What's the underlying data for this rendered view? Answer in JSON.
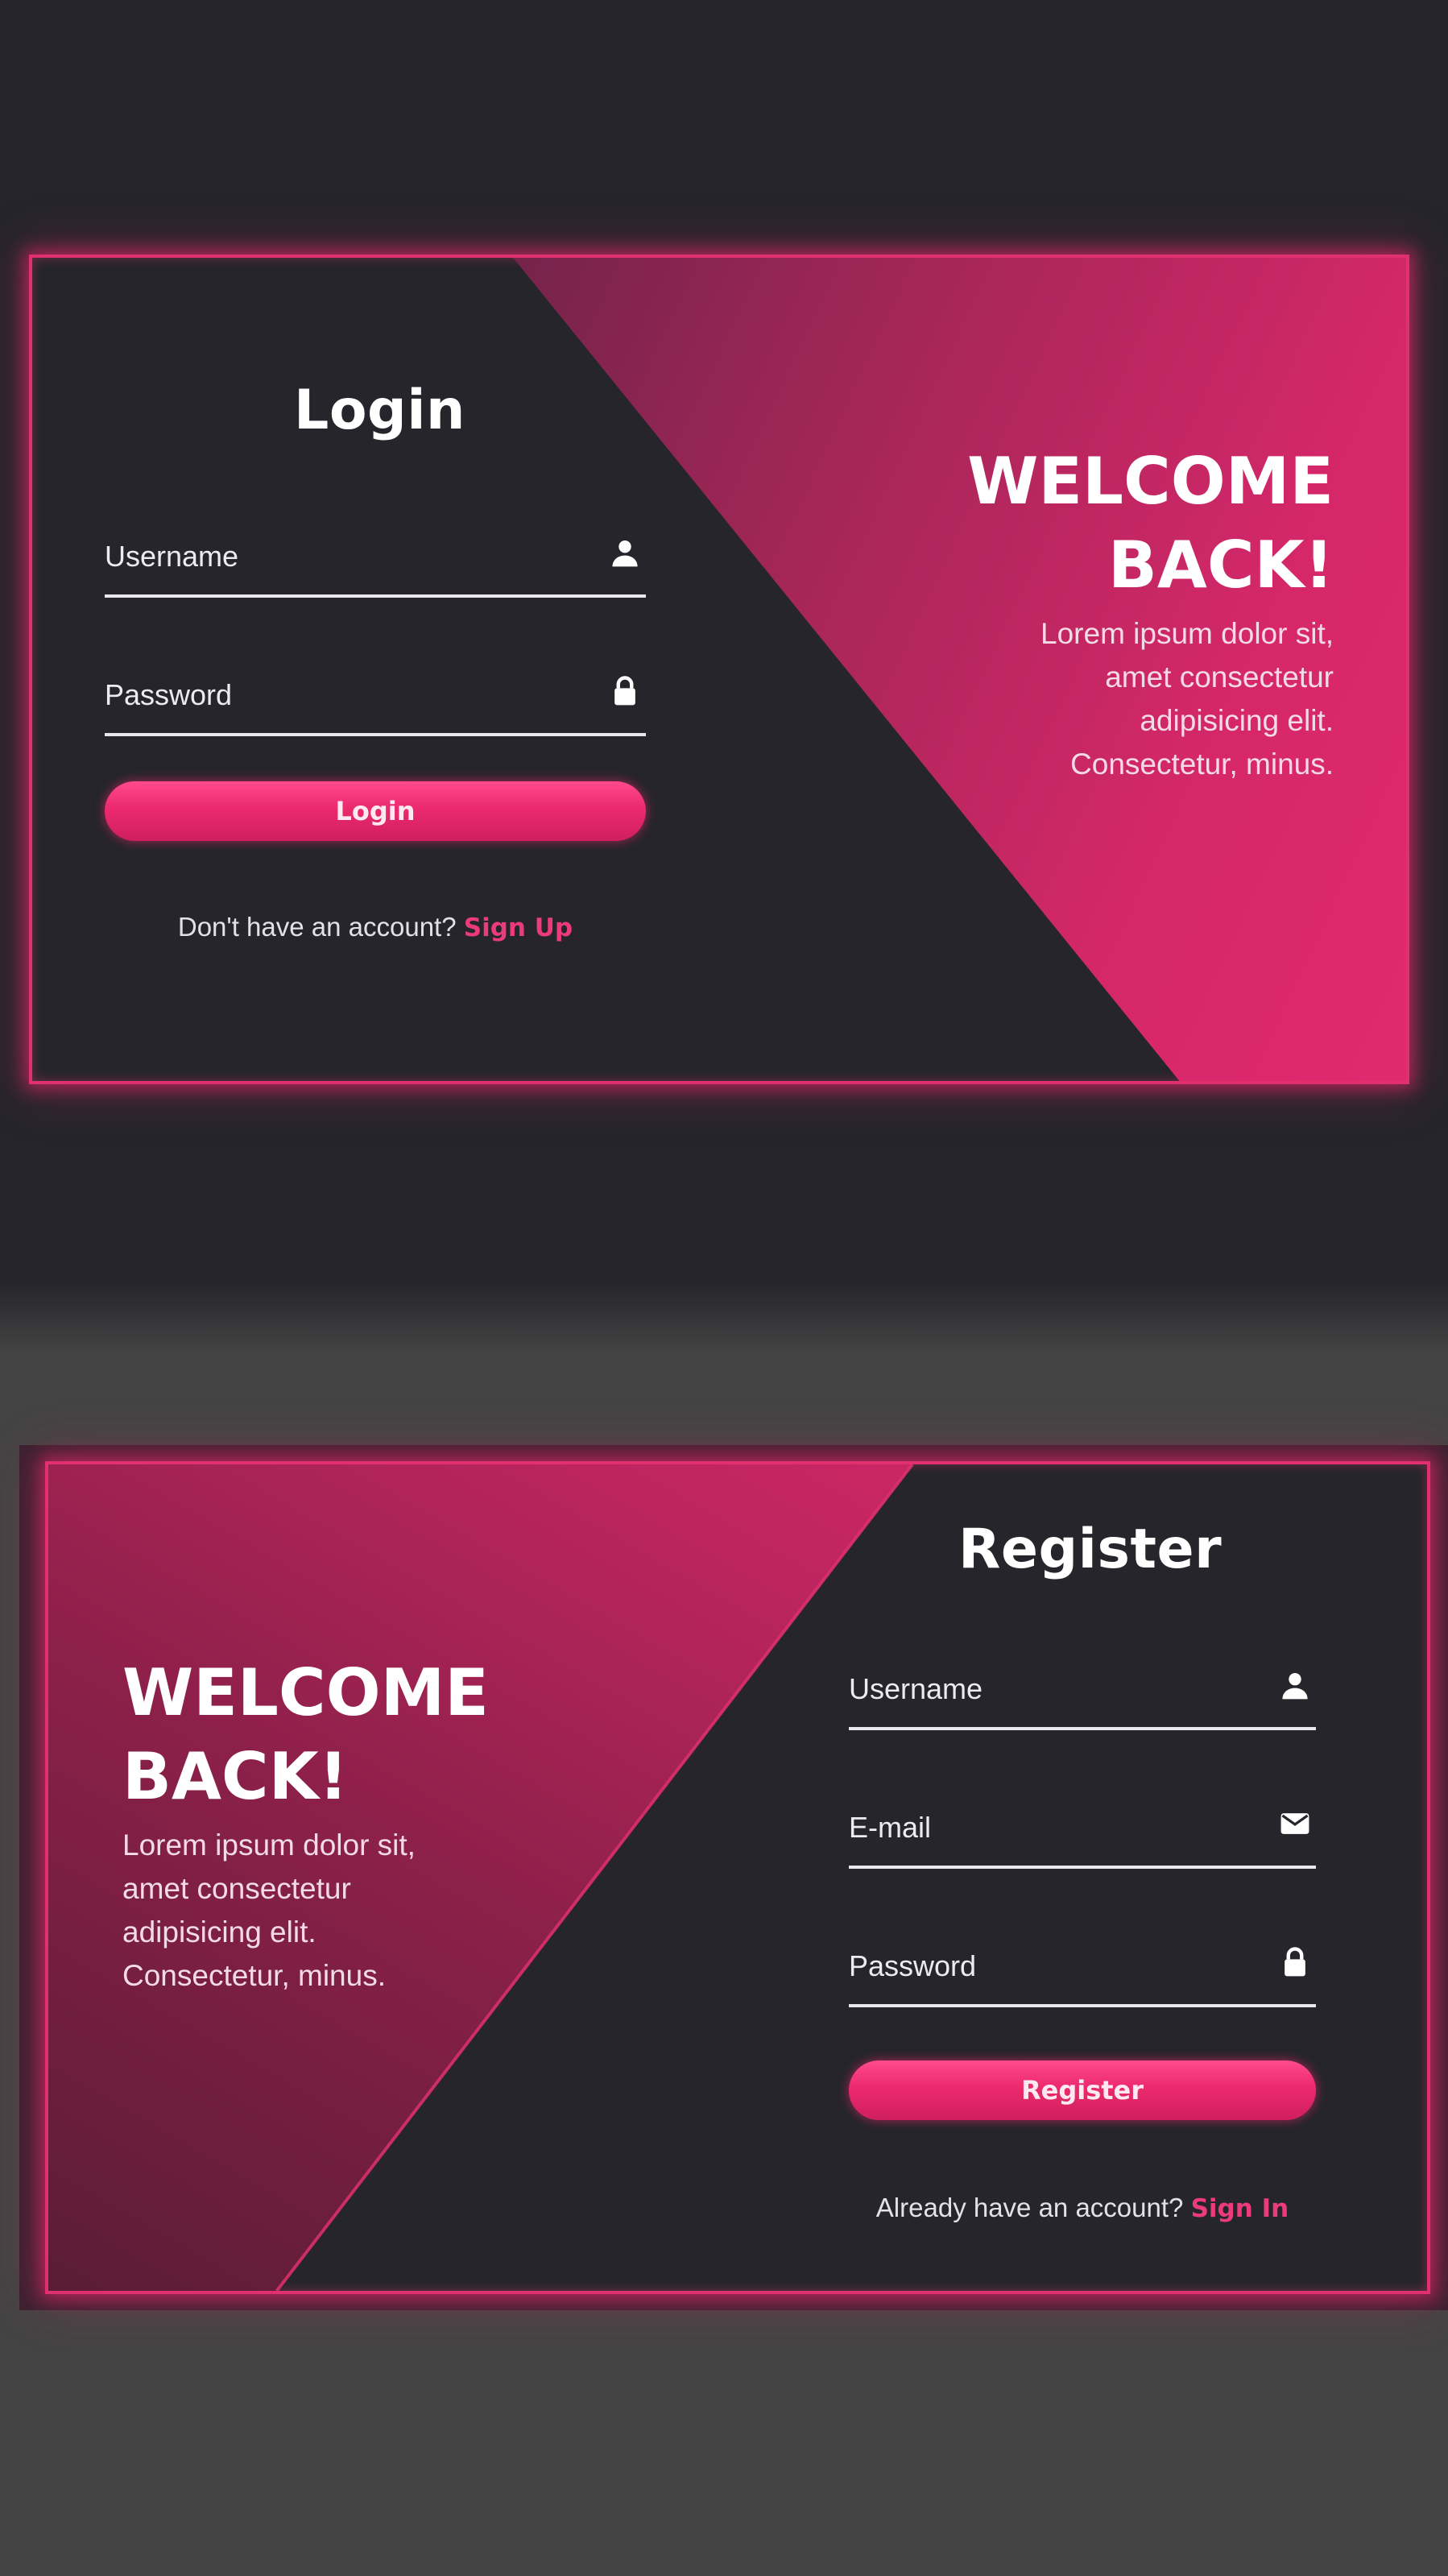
{
  "login_card": {
    "title": "Login",
    "username_label": "Username",
    "password_label": "Password",
    "button_label": "Login",
    "footer_text": "Don't have an account?",
    "footer_link": "Sign Up",
    "welcome_line1": "WELCOME",
    "welcome_line2": "BACK!",
    "welcome_body": [
      "Lorem ipsum dolor sit,",
      "amet consectetur",
      "adipisicing elit.",
      "Consectetur, minus."
    ]
  },
  "register_card": {
    "title": "Register",
    "username_label": "Username",
    "email_label": "E-mail",
    "password_label": "Password",
    "button_label": "Register",
    "footer_text": "Already have an account?",
    "footer_link": "Sign In",
    "welcome_line1": "WELCOME",
    "welcome_line2": "BACK!",
    "welcome_body": [
      "Lorem ipsum dolor sit,",
      "amet consectetur",
      "adipisicing elit.",
      "Consectetur, minus."
    ]
  },
  "icons": {
    "username": "user-icon",
    "password": "lock-icon",
    "email": "mail-icon"
  },
  "colors": {
    "accent": "#e0306d",
    "link": "#ec3b7a",
    "card_bg": "#25252b",
    "page_top_bg": "#25252b",
    "page_bottom_bg": "#444444"
  }
}
